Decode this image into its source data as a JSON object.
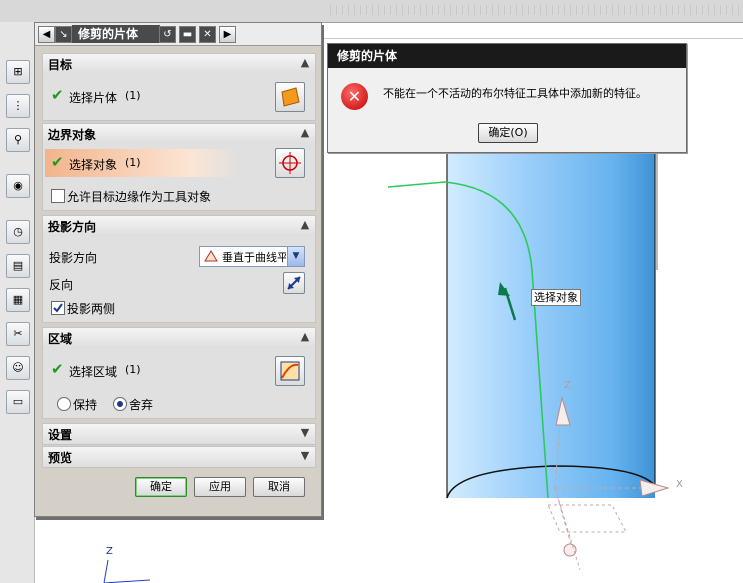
{
  "dialog": {
    "title": "修剪的片体",
    "sections": {
      "target": {
        "header": "目标",
        "select_label": "选择片体",
        "select_count": "(1)"
      },
      "boundary": {
        "header": "边界对象",
        "select_label": "选择对象",
        "select_count": "(1)",
        "allow_edge_label": "允许目标边缘作为工具对象",
        "allow_edge_checked": false
      },
      "projection": {
        "header": "投影方向",
        "direction_label": "投影方向",
        "direction_value": "垂直于曲线平面",
        "reverse_label": "反向",
        "both_sides_label": "投影两侧",
        "both_sides_checked": true
      },
      "region": {
        "header": "区域",
        "select_label": "选择区域",
        "select_count": "(1)",
        "keep_label": "保持",
        "discard_label": "舍弃",
        "selected": "discard"
      },
      "settings": {
        "header": "设置"
      },
      "preview": {
        "header": "预览"
      }
    },
    "buttons": {
      "ok": "确定",
      "apply": "应用",
      "cancel": "取消"
    }
  },
  "error_dialog": {
    "title": "修剪的片体",
    "message": "不能在一个不活动的布尔特征工具体中添加新的特征。",
    "ok_button": "确定(O)"
  },
  "viewport": {
    "tooltip": "选择对象",
    "axis_x": "X",
    "axis_y": "Y",
    "axis_z": "Z",
    "axis_z_small": "Z"
  },
  "colors": {
    "cylinder_light": "#b9e0ff",
    "cylinder_dark": "#3e93d6",
    "curve_green": "#2ec95a",
    "selection_orange": "#f2b48c",
    "check_green": "#1d9b1d",
    "error_red": "#c20000"
  },
  "left_toolbar": {
    "icons": [
      "assembly-nav-icon",
      "part-nav-icon",
      "constraint-icon",
      "web-browser-icon",
      "history-icon",
      "document-icon",
      "color-palette-icon",
      "weld-icon",
      "roles-icon",
      "system-scene-icon"
    ]
  }
}
